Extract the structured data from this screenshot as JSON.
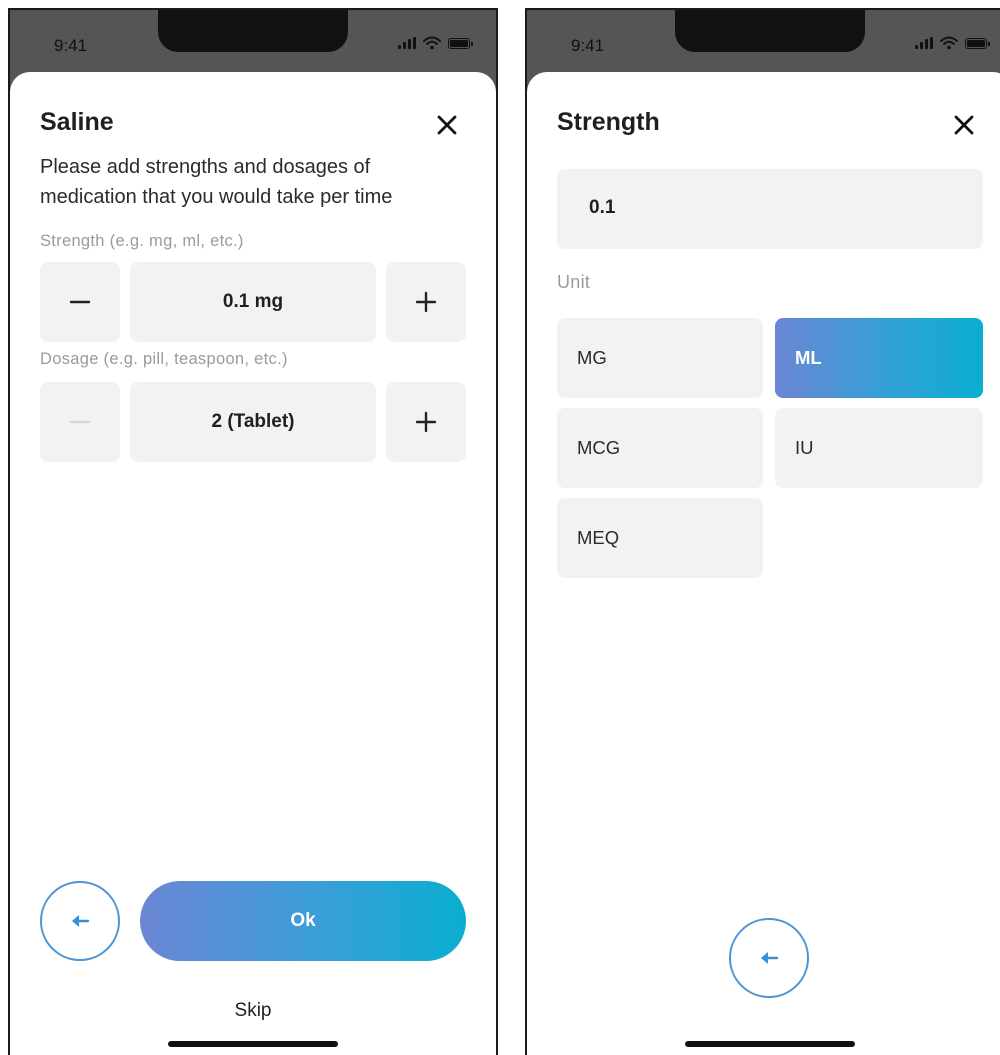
{
  "left_screen": {
    "status_time": "9:41",
    "title": "Saline",
    "description": "Please add strengths and dosages of medication that you would take per time",
    "strength": {
      "label": "Strength (e.g. mg, ml, etc.)",
      "value": "0.1 mg"
    },
    "dosage": {
      "label": "Dosage (e.g. pill, teaspoon, etc.)",
      "value": "2 (Tablet)"
    },
    "ok_label": "Ok",
    "skip_label": "Skip"
  },
  "right_screen": {
    "status_time": "9:41",
    "title": "Strength",
    "value": "0.1",
    "unit_label": "Unit",
    "units": [
      "MG",
      "ML",
      "MCG",
      "IU",
      "MEQ"
    ],
    "selected_unit": "ML"
  },
  "colors": {
    "gradient_start": "#6b86d4",
    "gradient_end": "#0aaed0",
    "back_button_border": "#4a96d6",
    "tile_background": "#f2f2f2",
    "disabled_control": "#d8d8d8"
  },
  "icons": [
    "close-icon",
    "minus-icon",
    "plus-icon",
    "arrow-left-icon",
    "signal-icon",
    "wifi-icon",
    "battery-icon"
  ]
}
